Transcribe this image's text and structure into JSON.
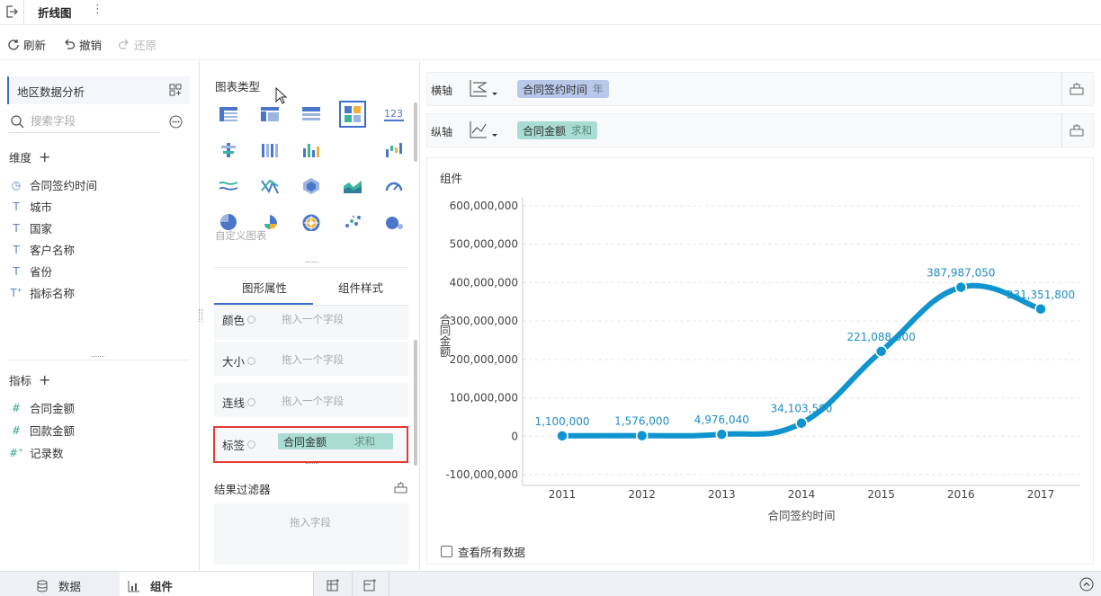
{
  "window": {
    "tab_title": "折线图",
    "more_icon": "more-vertical-icon"
  },
  "toolbar": {
    "refresh": "刷新",
    "undo": "撤销",
    "redo": "还原"
  },
  "left": {
    "dataset_name": "地区数据分析",
    "search_placeholder": "搜索字段",
    "dimension_title": "维度",
    "dimensions": [
      "合同签约时间",
      "城市",
      "国家",
      "客户名称",
      "省份",
      "指标名称"
    ],
    "measure_title": "指标",
    "measures": [
      "合同金额",
      "回款金额",
      "记录数"
    ]
  },
  "middle": {
    "chart_type_title": "图表类型",
    "custom_chart_label": "自定义图表",
    "tabs": [
      "图形属性",
      "组件样式"
    ],
    "properties": [
      {
        "label": "颜色",
        "placeholder": "拖入一个字段"
      },
      {
        "label": "大小",
        "placeholder": "拖入一个字段"
      },
      {
        "label": "连线",
        "placeholder": "拖入一个字段"
      },
      {
        "label": "标签",
        "field": "合同金额",
        "aggregation": "求和"
      }
    ],
    "result_filter_title": "结果过滤器",
    "result_filter_placeholder": "拖入字段"
  },
  "right": {
    "x_axis_label": "横轴",
    "x_field": "合同签约时间",
    "x_field_granularity": "年",
    "y_axis_label": "纵轴",
    "y_field": "合同金额",
    "y_field_aggregation": "求和",
    "component_title": "组件",
    "show_all_data": "查看所有数据"
  },
  "colors": {
    "accent": "#3d6dcc",
    "line": "#0f94cf",
    "x_pill": "#b7c8ea",
    "y_pill": "#a9dcd2"
  },
  "chart_data": {
    "type": "line",
    "smooth": true,
    "x": [
      "2011",
      "2012",
      "2013",
      "2014",
      "2015",
      "2016",
      "2017"
    ],
    "series": [
      {
        "name": "合同金额",
        "values": [
          1100000,
          1576000,
          4976040,
          34103580,
          221088000,
          387987050,
          331351800
        ]
      }
    ],
    "data_labels": [
      "1,100,000",
      "1,576,000",
      "4,976,040",
      "34,103,580",
      "221,088,000",
      "387,987,050",
      "331,351,800"
    ],
    "yticks": [
      "600,000,000",
      "500,000,000",
      "400,000,000",
      "300,000,000",
      "200,000,000",
      "100,000,000",
      "0",
      "-100,000,000"
    ],
    "ytick_values": [
      600000000,
      500000000,
      400000000,
      300000000,
      200000000,
      100000000,
      0,
      -100000000
    ],
    "ylim": [
      -100000000,
      600000000
    ],
    "xlabel": "合同签约时间",
    "ylabel": "合同金额",
    "grid": true
  },
  "bottom": {
    "tabs": [
      "数据",
      "组件"
    ],
    "active": "组件"
  }
}
